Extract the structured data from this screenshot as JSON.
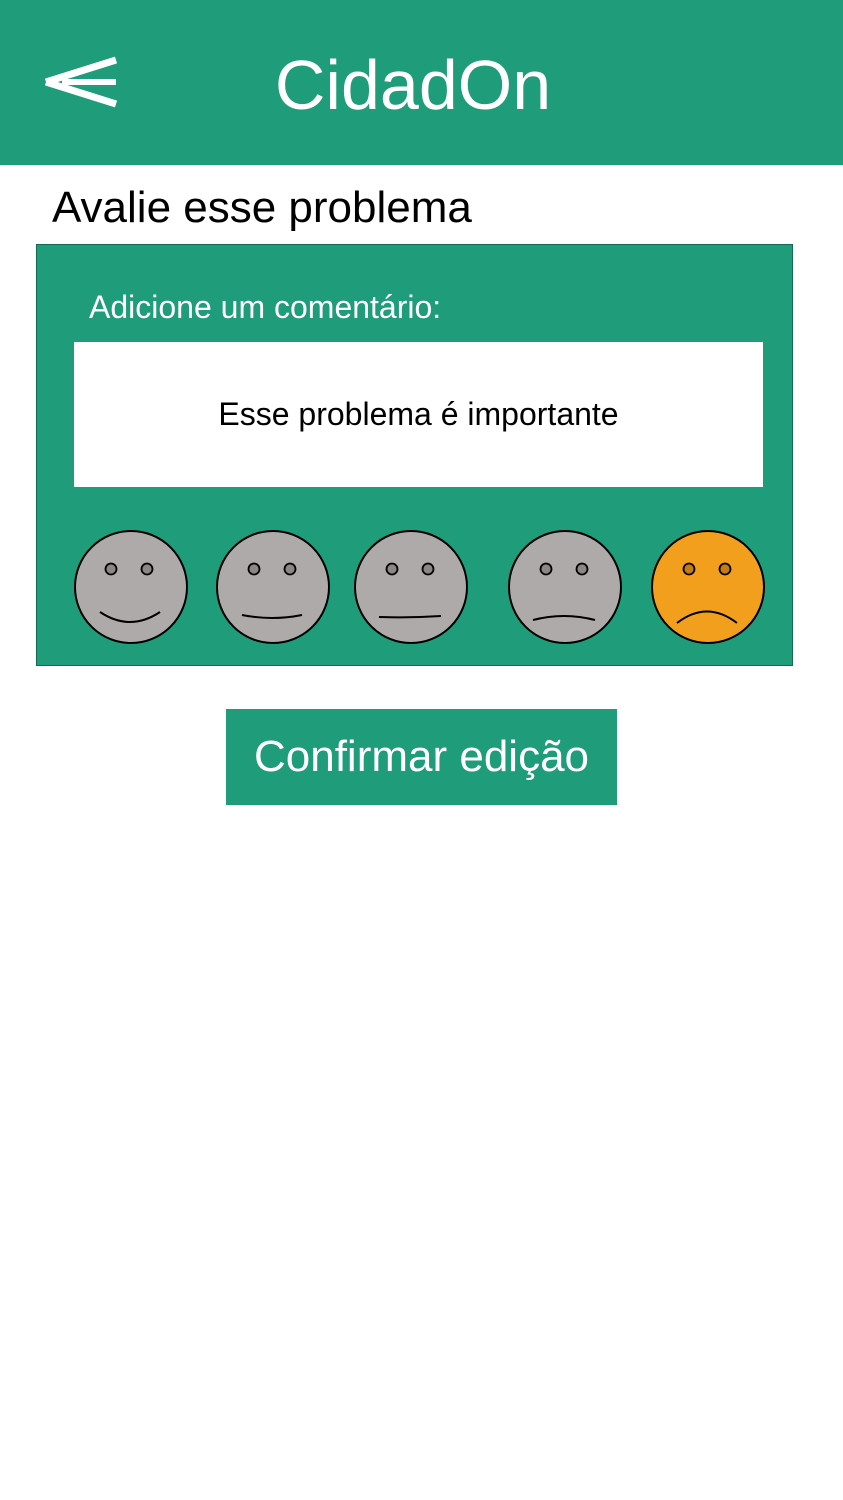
{
  "header": {
    "title": "CidadOn",
    "back_icon": "back-arrow-icon",
    "background_color": "#1f9c7a"
  },
  "page": {
    "title": "Avalie esse problema"
  },
  "rating": {
    "comment_label": "Adicione um comentário:",
    "comment_value": "Esse problema é importante",
    "options": [
      {
        "icon": "very-happy-face-icon",
        "selected": false
      },
      {
        "icon": "happy-face-icon",
        "selected": false
      },
      {
        "icon": "neutral-face-icon",
        "selected": false
      },
      {
        "icon": "sad-face-icon",
        "selected": false
      },
      {
        "icon": "very-sad-face-icon",
        "selected": true
      }
    ],
    "selected_color": "#f29f1d",
    "unselected_color": "#aeaaa9"
  },
  "actions": {
    "confirm_label": "Confirmar edição"
  }
}
